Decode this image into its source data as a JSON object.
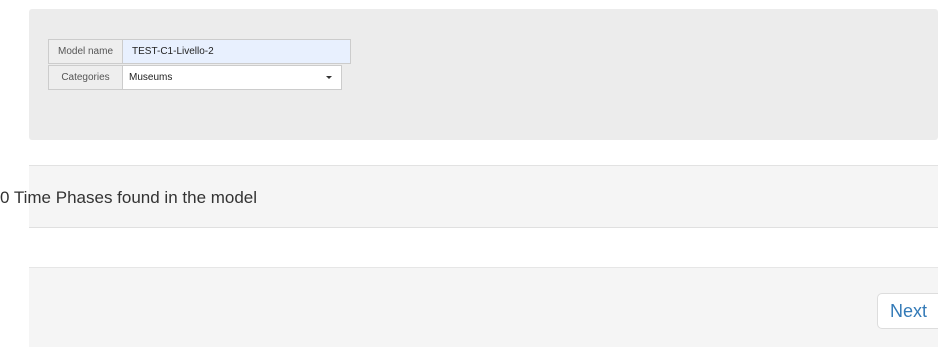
{
  "form": {
    "model_name": {
      "label": "Model name",
      "value": "TEST-C1-Livello-2"
    },
    "categories": {
      "label": "Categories",
      "selected": "Museums"
    }
  },
  "phases": {
    "heading": "0 Time Phases found in the model"
  },
  "footer": {
    "next_label": "Next"
  }
}
